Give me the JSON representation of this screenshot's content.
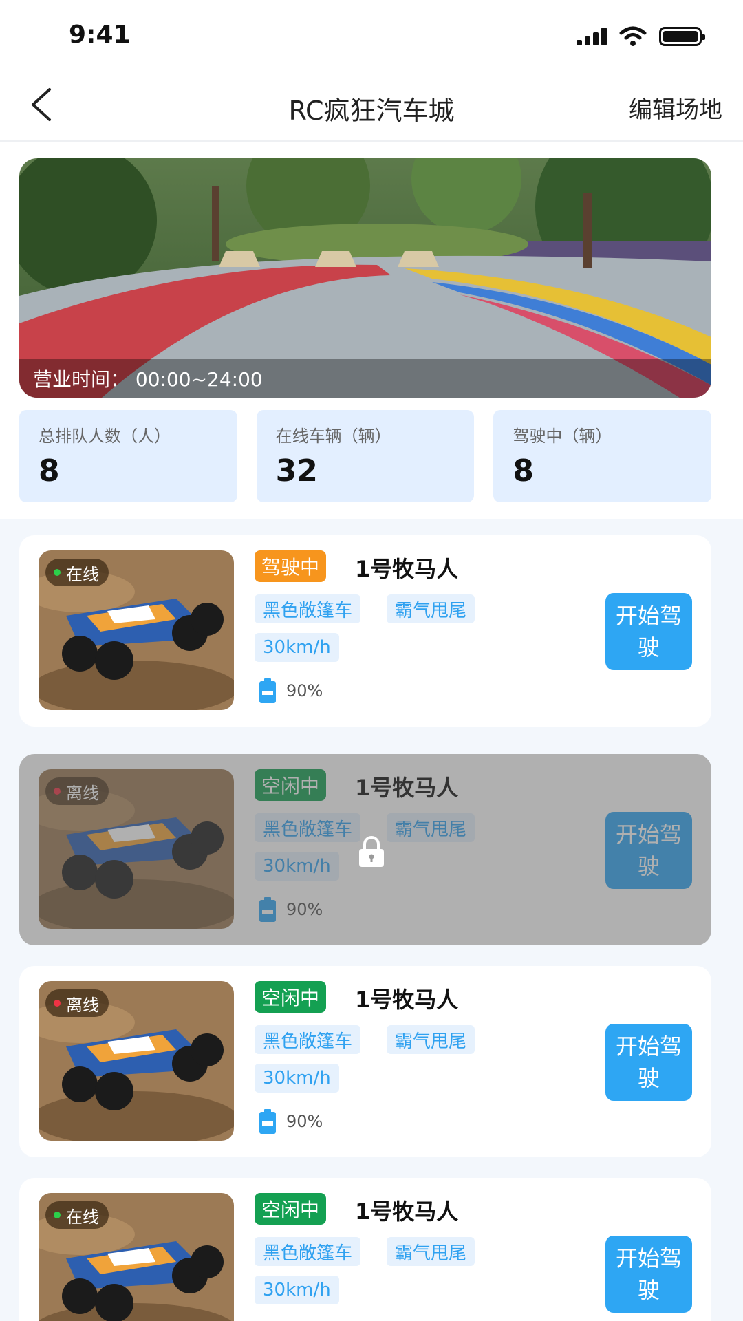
{
  "status_bar": {
    "time": "9:41"
  },
  "nav": {
    "title": "RC疯狂汽车城",
    "edit_label": "编辑场地"
  },
  "banner": {
    "hours_text": "营业时间：  00:00~24:00"
  },
  "stats": [
    {
      "label": "总排队人数（人）",
      "value": "8"
    },
    {
      "label": "在线车辆（辆）",
      "value": "32"
    },
    {
      "label": "驾驶中（辆）",
      "value": "8"
    }
  ],
  "cars": [
    {
      "online": "在线",
      "status": "驾驶中",
      "name": "1号牧马人",
      "tag1": "黑色敞篷车",
      "tag2": "霸气甩尾",
      "speed": "30km/h",
      "battery": "90%",
      "start_label": "开始驾驶",
      "locked": false
    },
    {
      "online": "离线",
      "status": "空闲中",
      "name": "1号牧马人",
      "tag1": "黑色敞篷车",
      "tag2": "霸气甩尾",
      "speed": "30km/h",
      "battery": "90%",
      "start_label": "开始驾驶",
      "locked": true
    },
    {
      "online": "离线",
      "status": "空闲中",
      "name": "1号牧马人",
      "tag1": "黑色敞篷车",
      "tag2": "霸气甩尾",
      "speed": "30km/h",
      "battery": "90%",
      "start_label": "开始驾驶",
      "locked": false
    },
    {
      "online": "在线",
      "status": "空闲中",
      "name": "1号牧马人",
      "tag1": "黑色敞篷车",
      "tag2": "霸气甩尾",
      "speed": "30km/h",
      "battery": "",
      "start_label": "开始驾驶",
      "locked": false
    }
  ],
  "colors": {
    "accent": "#2ea6f3",
    "driving": "#f7951d",
    "idle": "#14a052",
    "online_dot": "#2ccf4a",
    "offline_dot": "#ee3344"
  },
  "icons": {
    "back": "back-arrow-icon",
    "battery": "battery-icon",
    "lock": "lock-icon",
    "signal": "signal-icon",
    "wifi": "wifi-icon"
  }
}
